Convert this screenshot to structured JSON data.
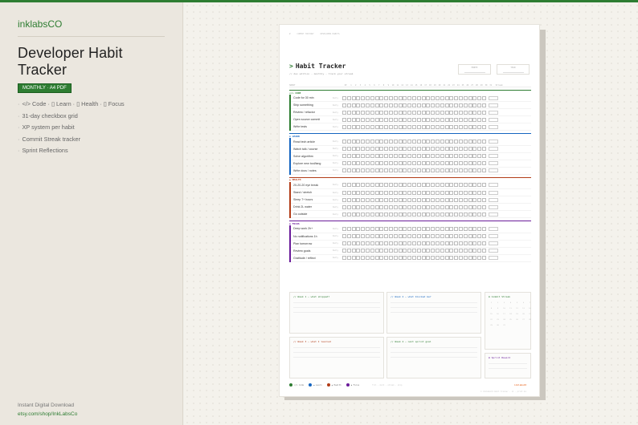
{
  "left": {
    "brand": "inklabsCO",
    "title": "Developer Habit Tracker",
    "badge": "MONTHLY · A4 PDF",
    "features": [
      "</> Code · ▯ Learn · ▯ Health · ▯ Focus",
      "31-day checkbox grid",
      "XP system per habit",
      "Commit Streak tracker",
      "Sprint Reflections"
    ],
    "footer_line1": "Instant Digital Download",
    "footer_line2": "etsy.com/shop/InkLabsCo"
  },
  "sheet": {
    "crumbs": [
      "#",
      "COMMIT HISTORY",
      "DEVELOPER HABITS"
    ],
    "title_prefix": ">",
    "title": "Habit Tracker",
    "subtitle": "// dev edition · monthly · track your streak",
    "month_label": "MONTH",
    "year_label": "YEAR",
    "col_habit": "HABIT",
    "col_xp": "XP",
    "days": [
      "1",
      "2",
      "3",
      "4",
      "5",
      "6",
      "7",
      "8",
      "9",
      "10",
      "11",
      "12",
      "13",
      "14",
      "15",
      "16",
      "17",
      "18",
      "19",
      "20",
      "21",
      "22",
      "23",
      "24",
      "25",
      "26",
      "27",
      "28",
      "29",
      "30",
      "31"
    ],
    "col_streak": "Streak",
    "categories": [
      {
        "title": "</> CODE",
        "color": "#2e7d32",
        "habits": [
          {
            "name": "Code for 30 min",
            "goal": "Daily"
          },
          {
            "name": "Ship something",
            "goal": "Daily"
          },
          {
            "name": "Review / refactor",
            "goal": "Daily"
          },
          {
            "name": "Open source commit",
            "goal": "Daily"
          },
          {
            "name": "Write tests",
            "goal": "Daily"
          }
        ]
      },
      {
        "title": "▪ LEARN",
        "color": "#1565c0",
        "habits": [
          {
            "name": "Read tech article",
            "goal": "Daily"
          },
          {
            "name": "Watch talk / course",
            "goal": "Daily"
          },
          {
            "name": "Solve algorithm",
            "goal": "Daily"
          },
          {
            "name": "Explore new tool/lang",
            "goal": "Daily"
          },
          {
            "name": "Write docs / notes",
            "goal": "Daily"
          }
        ]
      },
      {
        "title": "▲ HEALTH",
        "color": "#b23c17",
        "habits": [
          {
            "name": "20-20-20 eye break",
            "goal": "Daily"
          },
          {
            "name": "Stand / stretch",
            "goal": "Daily"
          },
          {
            "name": "Sleep 7+ hours",
            "goal": "Daily"
          },
          {
            "name": "Drink 2L water",
            "goal": "Daily"
          },
          {
            "name": "Go outside",
            "goal": "Daily"
          }
        ]
      },
      {
        "title": "◆ FOCUS",
        "color": "#6a1b9a",
        "habits": [
          {
            "name": "Deep work 2h+",
            "goal": "Daily"
          },
          {
            "name": "No notifications 1h",
            "goal": "Daily"
          },
          {
            "name": "Plan tomorrow",
            "goal": "Daily"
          },
          {
            "name": "Review goals",
            "goal": "Daily"
          },
          {
            "name": "Gratitude / reflect",
            "goal": "Daily"
          }
        ]
      }
    ],
    "panels": {
      "week1": "// Week 1 — what shipped?",
      "week2": "// Week 2 — what blocked me?",
      "week3": "// Week 3 — what I learned",
      "week4": "// Week 4 — next sprint goal",
      "commit": "▪ Commit Streak",
      "sprint": "▪ Sprint Reward"
    },
    "legend": [
      {
        "label": "</> Code",
        "color": "#2e7d32"
      },
      {
        "label": "▪ Learn",
        "color": "#1565c0"
      },
      {
        "label": "▲ Health",
        "color": "#b23c17"
      },
      {
        "label": "◆ Focus",
        "color": "#6a1b9a"
      }
    ],
    "legend_note": "fill · mark · streak · ship",
    "legend_brand": "inklabsCO",
    "foot": "© inklabsCO habit tracker · v1 · print A4"
  }
}
